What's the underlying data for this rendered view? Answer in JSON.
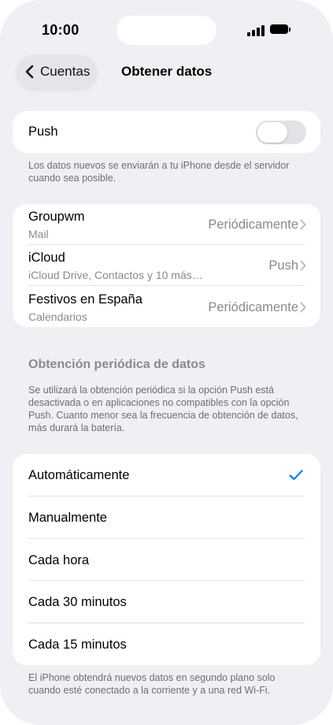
{
  "status": {
    "time": "10:00"
  },
  "nav": {
    "back_label": "Cuentas",
    "title": "Obtener datos"
  },
  "push": {
    "label": "Push",
    "enabled": false,
    "note": "Los datos nuevos se enviarán a tu iPhone desde el servidor cuando sea posible."
  },
  "accounts": [
    {
      "name": "Groupwm",
      "detail": "Mail",
      "value": "Periódicamente"
    },
    {
      "name": "iCloud",
      "detail": "iCloud Drive, Contactos y 10 más…",
      "value": "Push"
    },
    {
      "name": "Festivos en España",
      "detail": "Calendarios",
      "value": "Periódicamente"
    }
  ],
  "fetch": {
    "header": "Obtención periódica de datos",
    "note": "Se utilizará la obtención periódica si la opción Push está desactivada o en aplicaciones no compatibles con la opción Push. Cuanto menor sea la frecuencia de obtención de datos, más durará la batería.",
    "options": [
      "Automáticamente",
      "Manualmente",
      "Cada hora",
      "Cada 30 minutos",
      "Cada 15 minutos"
    ],
    "selected": "Automáticamente",
    "footer": "El iPhone obtendrá nuevos datos en segundo plano solo cuando esté conectado a la corriente y a una red Wi-Fi."
  },
  "colors": {
    "accent": "#007aff",
    "background": "#efeff4"
  }
}
